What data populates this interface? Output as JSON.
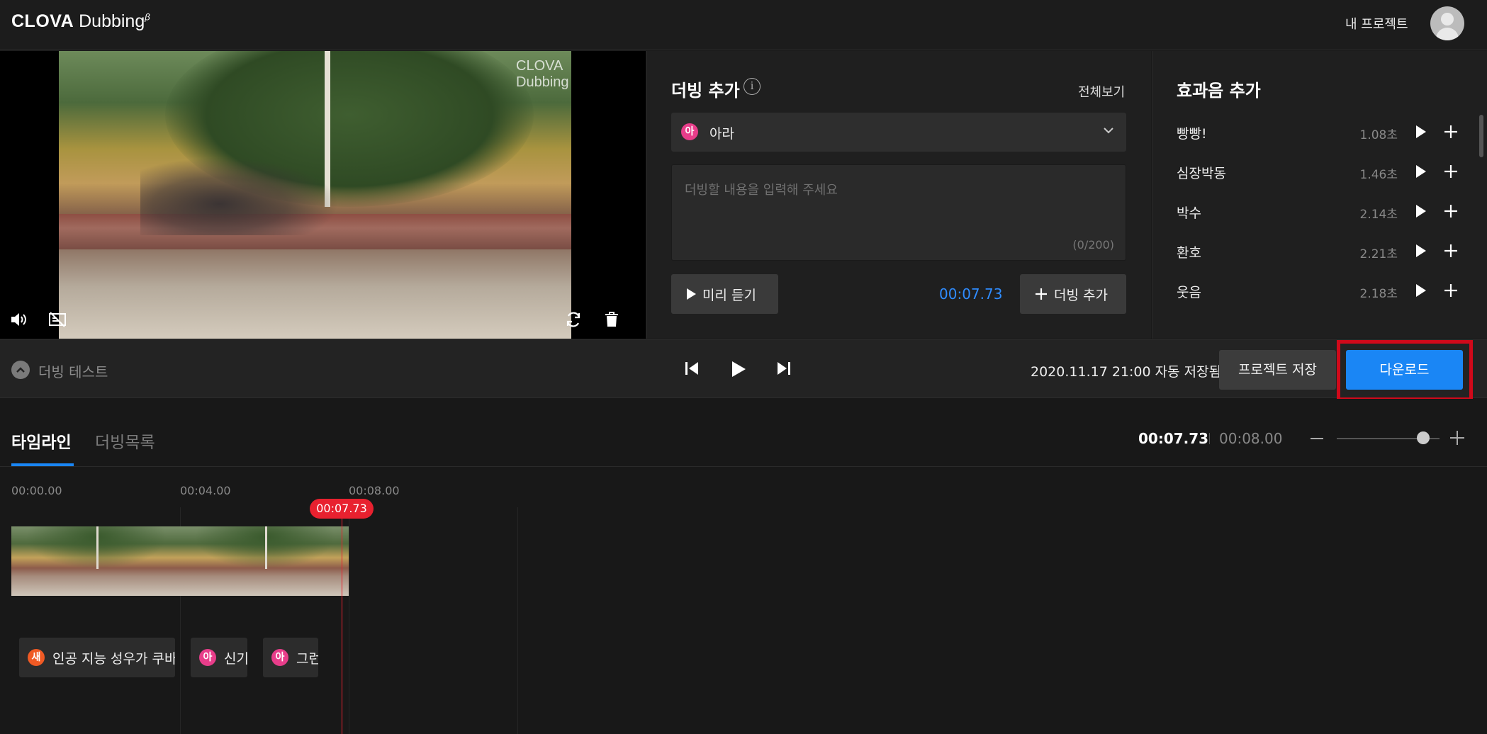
{
  "header": {
    "logo_bold": "CLOVA",
    "logo_light": "Dubbing",
    "logo_sup": "β",
    "my_projects": "내 프로젝트"
  },
  "video": {
    "watermark": "CLOVA Dubbing"
  },
  "dubbing_panel": {
    "title": "더빙 추가",
    "view_all": "전체보기",
    "voice_badge": "아",
    "voice_name": "아라",
    "text_placeholder": "더빙할 내용을 입력해 주세요",
    "char_count": "(0/200)",
    "preview_label": "미리 듣기",
    "time": "00:07.73",
    "add_label": "더빙 추가"
  },
  "sfx_panel": {
    "title": "효과음 추가",
    "items": [
      {
        "name": "빵빵!",
        "duration": "1.08초"
      },
      {
        "name": "심장박동",
        "duration": "1.46초"
      },
      {
        "name": "박수",
        "duration": "2.14초"
      },
      {
        "name": "환호",
        "duration": "2.21초"
      },
      {
        "name": "웃음",
        "duration": "2.18초"
      }
    ]
  },
  "control_bar": {
    "test_label": "더빙 테스트",
    "saved_status": "2020.11.17 21:00 자동 저장됨",
    "save_label": "프로젝트 저장",
    "download_label": "다운로드"
  },
  "timeline": {
    "tabs": [
      "타임라인",
      "더빙목록"
    ],
    "current_time": "00:07.73",
    "total_time": "00:08.00",
    "ruler": [
      "00:00.00",
      "00:04.00",
      "00:08.00"
    ],
    "playhead_label": "00:07.73",
    "dubs": [
      {
        "badge": "새",
        "text": "인공 지능 성우가 쿠바",
        "color": "#f05a24"
      },
      {
        "badge": "아",
        "text": "신기",
        "color": "#e83d8a"
      },
      {
        "badge": "아",
        "text": "그런",
        "color": "#e83d8a"
      }
    ]
  },
  "colors": {
    "accent": "#1a86f5",
    "playhead": "#e8212f",
    "highlight": "#d0091a"
  }
}
